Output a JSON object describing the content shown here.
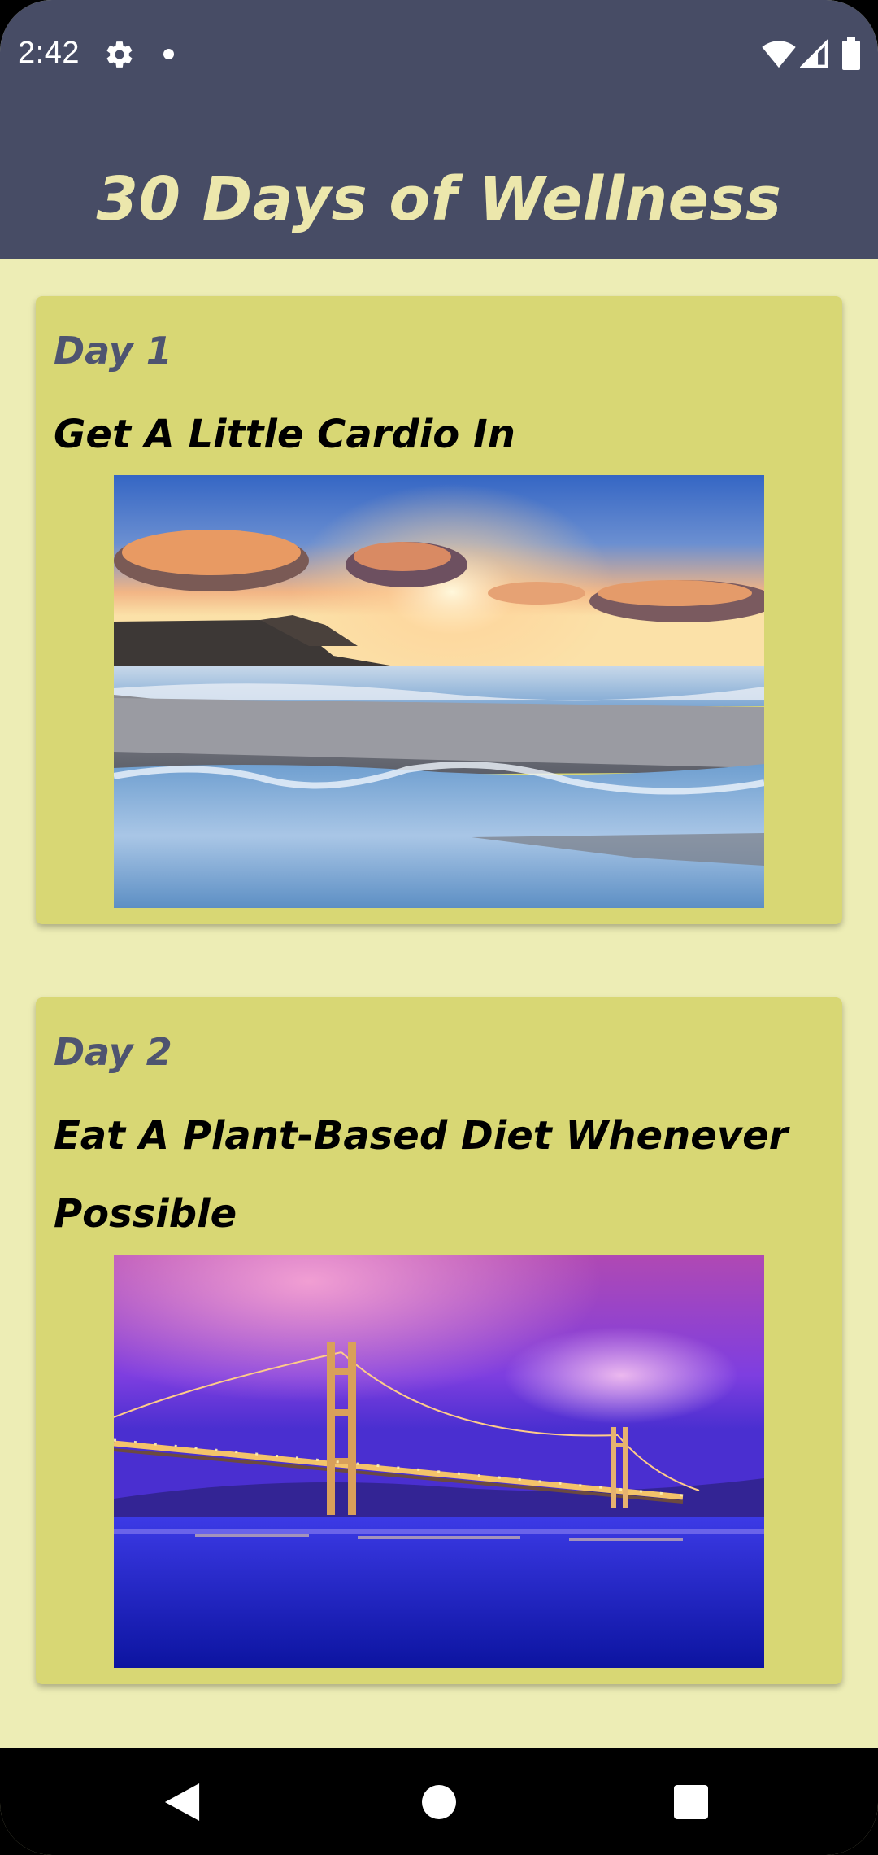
{
  "status_bar": {
    "time": "2:42",
    "icons": [
      "gear-icon",
      "notification-dot-icon",
      "wifi-icon",
      "signal-icon",
      "battery-icon"
    ]
  },
  "app_bar": {
    "title": "30 Days of Wellness"
  },
  "cards": [
    {
      "day": "Day 1",
      "title": "Get A Little Cardio In",
      "image": "beach-sunset-photo"
    },
    {
      "day": "Day 2",
      "title": "Eat A Plant-Based Diet Whenever Possible",
      "image": "golden-gate-bridge-night-photo"
    }
  ],
  "nav_bar": {
    "buttons": [
      "back",
      "home",
      "recents"
    ]
  },
  "colors": {
    "app_bar": "#474c65",
    "title_text": "#ece7ac",
    "background": "#ededb5",
    "card": "#d8d774",
    "day_label": "#4e5470"
  }
}
